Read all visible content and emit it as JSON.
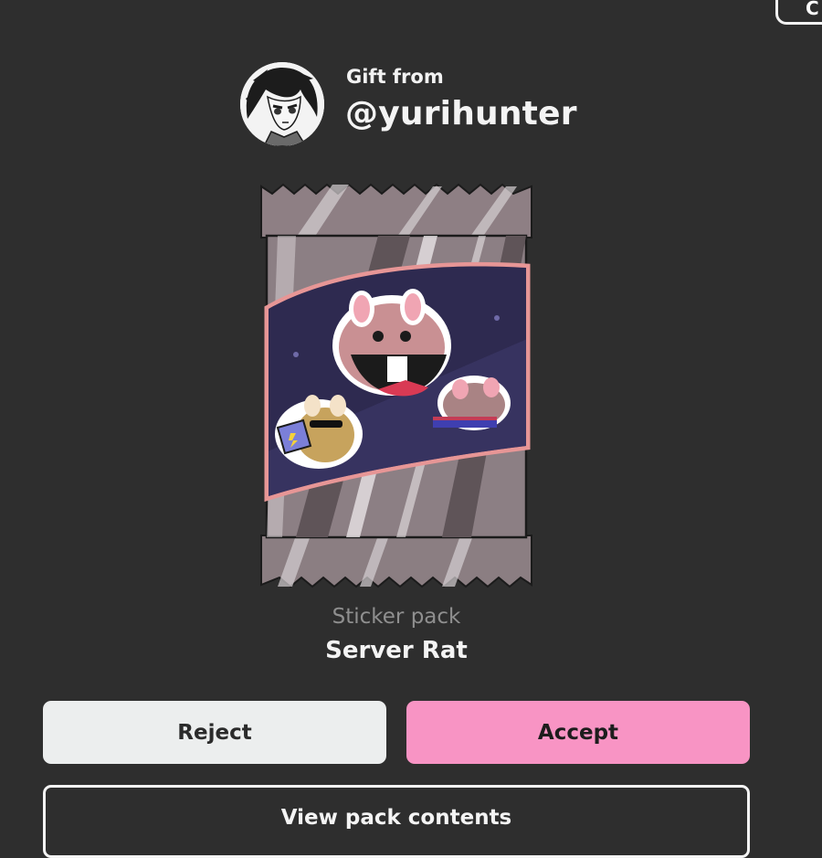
{
  "header": {
    "gift_label": "Gift from",
    "sender_handle": "@yurihunter",
    "avatar_icon": "anime-avatar-icon",
    "corner_button_label": "C"
  },
  "pack": {
    "type_label": "Sticker pack",
    "name": "Server Rat",
    "image_icon": "sticker-pack-wrapper-image"
  },
  "actions": {
    "reject_label": "Reject",
    "accept_label": "Accept",
    "view_contents_label": "View pack contents"
  },
  "colors": {
    "background": "#2e2e2e",
    "accept": "#f894c4",
    "reject": "#eceeee",
    "secondary_text": "#8f8f8f"
  }
}
